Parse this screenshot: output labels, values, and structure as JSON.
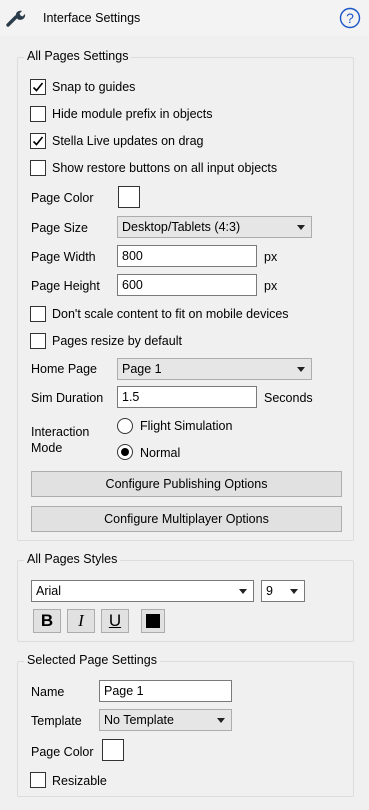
{
  "header": {
    "title": "Interface Settings",
    "help_icon": "help-circle-icon",
    "tool_icon": "wrench-icon"
  },
  "all_pages_settings": {
    "title": "All Pages Settings",
    "snap_to_guides": {
      "label": "Snap to guides",
      "checked": true
    },
    "hide_module_prefix": {
      "label": "Hide module prefix in objects",
      "checked": false
    },
    "stella_live_updates": {
      "label": "Stella Live updates on drag",
      "checked": true
    },
    "show_restore_buttons": {
      "label": "Show restore buttons on all input objects",
      "checked": false
    },
    "page_color_label": "Page Color",
    "page_size_label": "Page Size",
    "page_size_value": "Desktop/Tablets (4:3)",
    "page_width_label": "Page Width",
    "page_width_value": "800",
    "page_width_unit": "px",
    "page_height_label": "Page Height",
    "page_height_value": "600",
    "page_height_unit": "px",
    "dont_scale": {
      "label": "Don't scale content to fit on mobile devices",
      "checked": false
    },
    "pages_resize": {
      "label": "Pages resize by default",
      "checked": false
    },
    "home_page_label": "Home Page",
    "home_page_value": "Page 1",
    "sim_duration_label": "Sim Duration",
    "sim_duration_value": "1.5",
    "sim_duration_unit": "Seconds",
    "interaction_mode_label_line1": "Interaction",
    "interaction_mode_label_line2": "Mode",
    "interaction_options": [
      "Flight Simulation",
      "Normal"
    ],
    "interaction_selected": "Normal",
    "publishing_button": "Configure Publishing Options",
    "multiplayer_button": "Configure Multiplayer Options"
  },
  "all_pages_styles": {
    "title": "All Pages Styles",
    "font_value": "Arial",
    "size_value": "9",
    "bold_label": "B",
    "italic_label": "I",
    "underline_label": "U",
    "text_color": "#000000"
  },
  "selected_page_settings": {
    "title": "Selected Page Settings",
    "name_label": "Name",
    "name_value": "Page 1",
    "template_label": "Template",
    "template_value": "No Template",
    "page_color_label": "Page Color",
    "resizable": {
      "label": "Resizable",
      "checked": false
    }
  },
  "colors": {
    "panel_bg": "#f0f0f0",
    "help_blue": "#1a56c8",
    "button_bg": "#e1e1e1"
  }
}
